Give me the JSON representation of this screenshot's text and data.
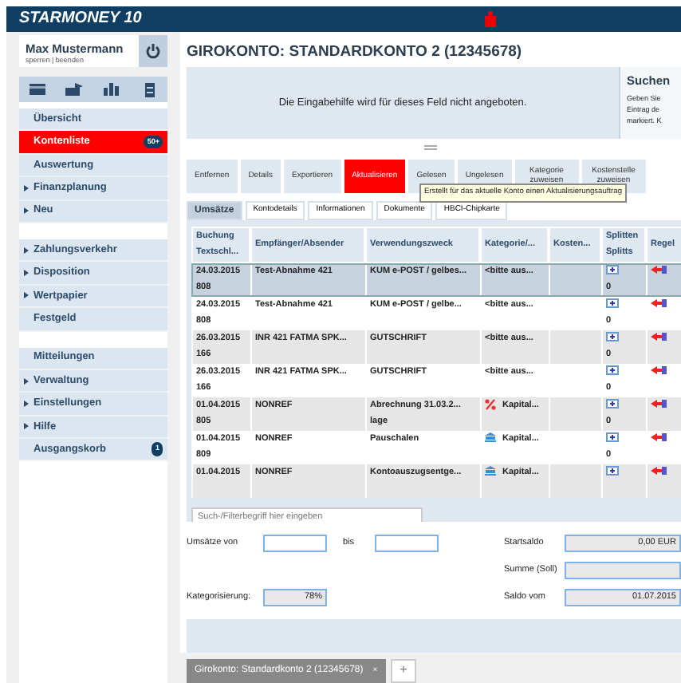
{
  "app": {
    "logo": "STARMONEY 10"
  },
  "user": {
    "name": "Max Mustermann",
    "actions": "sperren | beenden"
  },
  "sidebar": {
    "groups": [
      [
        {
          "label": "Übersicht",
          "expandable": false,
          "selected": false
        },
        {
          "label": "Kontenliste",
          "expandable": false,
          "selected": true,
          "badge": "50+"
        },
        {
          "label": "Auswertung",
          "expandable": false,
          "selected": false
        },
        {
          "label": "Finanzplanung",
          "expandable": true,
          "selected": false
        },
        {
          "label": "Neu",
          "expandable": true,
          "selected": false
        }
      ],
      [
        {
          "label": "Zahlungsverkehr",
          "expandable": true,
          "selected": false
        },
        {
          "label": "Disposition",
          "expandable": true,
          "selected": false
        },
        {
          "label": "Wertpapier",
          "expandable": true,
          "selected": false
        },
        {
          "label": "Festgeld",
          "expandable": false,
          "selected": false
        }
      ],
      [
        {
          "label": "Mitteilungen",
          "expandable": false,
          "selected": false
        },
        {
          "label": "Verwaltung",
          "expandable": true,
          "selected": false
        },
        {
          "label": "Einstellungen",
          "expandable": true,
          "selected": false
        },
        {
          "label": "Hilfe",
          "expandable": true,
          "selected": false
        },
        {
          "label": "Ausgangskorb",
          "expandable": false,
          "selected": false,
          "badge": "1"
        }
      ]
    ]
  },
  "title": "GIROKONTO: STANDARDKONTO 2 (12345678)",
  "helper_text": "Die Eingabehilfe wird für dieses Feld nicht angeboten.",
  "search_panel": {
    "title": "Suchen",
    "lines": [
      "Geben Sie",
      "Eintrag de",
      "markiert. K"
    ]
  },
  "toolbar": [
    {
      "label": "Entfernen",
      "highlighted": false
    },
    {
      "label": "Details",
      "highlighted": false
    },
    {
      "label": "Exportieren",
      "highlighted": false
    },
    {
      "label": "Aktualisieren",
      "highlighted": true
    },
    {
      "label": "Gelesen",
      "highlighted": false
    },
    {
      "label": "Ungelesen",
      "highlighted": false
    },
    {
      "label": "Kategorie zuweisen",
      "highlighted": false
    },
    {
      "label": "Kostenstelle zuweisen",
      "highlighted": false
    }
  ],
  "tooltip": "Erstellt für das aktuelle Konto einen Aktualisierungsauftrag",
  "subtabs": [
    {
      "label": "Umsätze",
      "selected": true
    },
    {
      "label": "Kontodetails",
      "selected": false
    },
    {
      "label": "Informationen",
      "selected": false
    },
    {
      "label": "Dokumente",
      "selected": false
    },
    {
      "label": "HBCI-Chipkarte",
      "selected": false
    }
  ],
  "table": {
    "columns": [
      [
        "Buchung",
        "Textschl..."
      ],
      [
        "Empfänger/Absender"
      ],
      [
        "Verwendungszweck"
      ],
      [
        "Kategorie/..."
      ],
      [
        "Kosten..."
      ],
      [
        "Splitten",
        "Splitts"
      ],
      [
        "Regel"
      ]
    ],
    "rows": [
      {
        "date": "24.03.2015",
        "key": "808",
        "party": "Test-Abnahme 421",
        "purpose": "KUM e-POST / gelbes...",
        "category": {
          "kind": "plain",
          "label": "<bitte aus..."
        },
        "splits": "0",
        "selected": true
      },
      {
        "date": "24.03.2015",
        "key": "808",
        "party": "Test-Abnahme 421",
        "purpose": "KUM e-POST / gelbe...",
        "category": {
          "kind": "plain",
          "label": "<bitte aus..."
        },
        "splits": "0",
        "selected": false
      },
      {
        "date": "26.03.2015",
        "key": "166",
        "party": "INR 421 FATMA SPK...",
        "purpose": "GUTSCHRIFT",
        "category": {
          "kind": "plain",
          "label": "<bitte aus..."
        },
        "splits": "0",
        "selected": false
      },
      {
        "date": "26.03.2015",
        "key": "166",
        "party": "INR 421 FATMA SPK...",
        "purpose": "GUTSCHRIFT",
        "category": {
          "kind": "plain",
          "label": "<bitte aus..."
        },
        "splits": "0",
        "selected": false
      },
      {
        "date": "01.04.2015",
        "key": "805",
        "party": "NONREF",
        "purpose": "Abrechnung 31.03.2...",
        "purpose_line2": "lage",
        "category": {
          "kind": "percent",
          "label": "Kapital..."
        },
        "splits": "0",
        "selected": false
      },
      {
        "date": "01.04.2015",
        "key": "809",
        "party": "NONREF",
        "purpose": "Pauschalen",
        "category": {
          "kind": "bank",
          "label": "Kapital..."
        },
        "splits": "0",
        "selected": false
      },
      {
        "date": "01.04.2015",
        "party": "NONREF",
        "purpose": "Kontoauszugsentge...",
        "category": {
          "kind": "bank",
          "label": "Kapital..."
        },
        "selected": false
      }
    ]
  },
  "filter": {
    "placeholder": "Such-/Filterbegriff hier eingeben"
  },
  "form": {
    "from_label": "Umsätze von",
    "to_label": "bis",
    "categorization_label": "Kategorisierung:",
    "categorization": "78%",
    "start_label": "Startsaldo",
    "start_value": "0,00 EUR",
    "sum_label": "Summe (Soll)",
    "balance_label": "Saldo vom",
    "balance_value": "01.07.2015"
  },
  "doc_tabs": [
    {
      "label": "Girokonto: Standardkonto 2 (12345678)",
      "close": "×"
    }
  ],
  "new_tab": "+"
}
